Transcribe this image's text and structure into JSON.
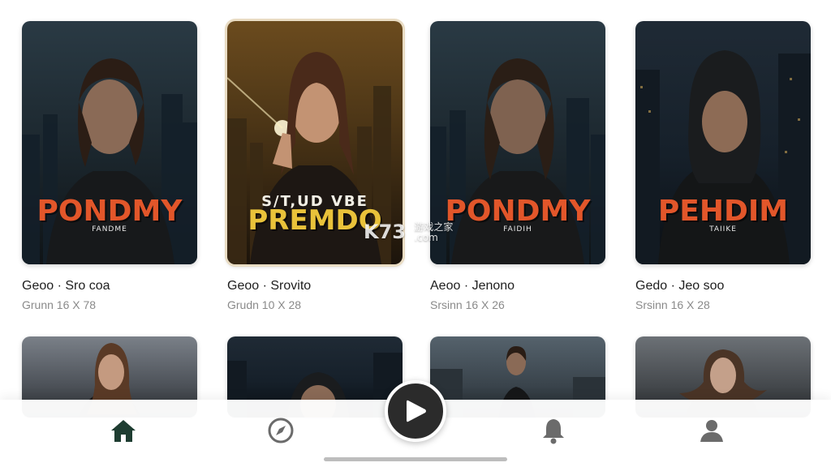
{
  "movies": [
    {
      "poster_title": "PONDMY",
      "poster_subtitle": "FANDME",
      "title": "Geoo · Sro coa",
      "meta": "Grunn 16 X 78"
    },
    {
      "poster_tagline": "S/T,UD VBE",
      "poster_title": "PREMDO",
      "title": "Geoo · Srovito",
      "meta": "Grudn 10 X 28"
    },
    {
      "poster_title": "PONDMY",
      "poster_subtitle": "FAIDIH",
      "title": "Aeoo · Jenono",
      "meta": "Srsinn 16 X 26"
    },
    {
      "poster_title": "PEHDIM",
      "poster_subtitle": "TAIIKE",
      "title": "Gedo · Jeo soo",
      "meta": "Srsinn 16 X 28"
    }
  ],
  "watermark": {
    "brand": "K73",
    "cn": "游戏之家",
    "domain": ".com"
  },
  "nav": [
    {
      "icon": "home-icon",
      "active": true
    },
    {
      "icon": "compass-icon",
      "active": false
    },
    {
      "icon": "play-icon",
      "active": false
    },
    {
      "icon": "bell-icon",
      "active": false
    },
    {
      "icon": "profile-icon",
      "active": false
    }
  ],
  "colors": {
    "active_nav": "#1e3d31",
    "inactive_nav": "#6b6b6b",
    "poster_red": "#e2562a",
    "poster_yellow": "#e9c23a"
  }
}
